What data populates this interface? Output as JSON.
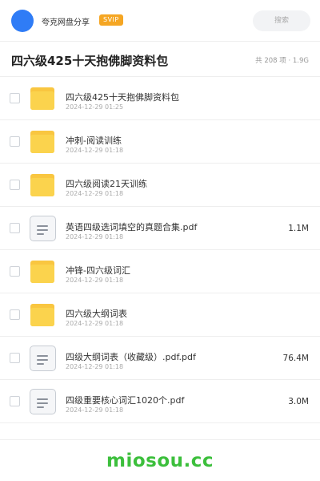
{
  "header": {
    "app_name": "夸克网盘分享",
    "badge": "SVIP",
    "search_placeholder": "搜索"
  },
  "title_bar": {
    "title": "四六级425十天抱佛脚资料包",
    "count": "共 208 项 · 1.9G"
  },
  "files": [
    {
      "type": "folder",
      "icon": "folder-icon",
      "name": "四六级425十天抱佛脚资料包",
      "date": "2024-12-29 01:25",
      "size": ""
    },
    {
      "type": "folder",
      "icon": "folder-icon",
      "name": "冲刺-阅读训练",
      "date": "2024-12-29 01:18",
      "size": ""
    },
    {
      "type": "folder",
      "icon": "folder-icon",
      "name": "四六级阅读21天训练",
      "date": "2024-12-29 01:18",
      "size": ""
    },
    {
      "type": "file",
      "icon": "document-icon",
      "name": "英语四级选词填空的真题合集.pdf",
      "date": "2024-12-29 01:18",
      "size": "1.1M"
    },
    {
      "type": "folder",
      "icon": "folder-icon",
      "name": "冲锋-四六级词汇",
      "date": "2024-12-29 01:18",
      "size": ""
    },
    {
      "type": "folder",
      "icon": "folder-icon",
      "name": "四六级大纲词表",
      "date": "2024-12-29 01:18",
      "size": ""
    },
    {
      "type": "file",
      "icon": "document-icon",
      "name": "四级大纲词表（收藏级）.pdf.pdf",
      "date": "2024-12-29 01:18",
      "size": "76.4M"
    },
    {
      "type": "file",
      "icon": "document-icon",
      "name": "四级重要核心词汇1020个.pdf",
      "date": "2024-12-29 01:18",
      "size": "3.0M"
    }
  ],
  "watermark": "miosou.cc",
  "colors": {
    "accent_blue": "#2f7cf6",
    "svip_orange": "#f5a623",
    "folder_yellow": "#fbd34d",
    "watermark_green": "#3cbf3c"
  }
}
